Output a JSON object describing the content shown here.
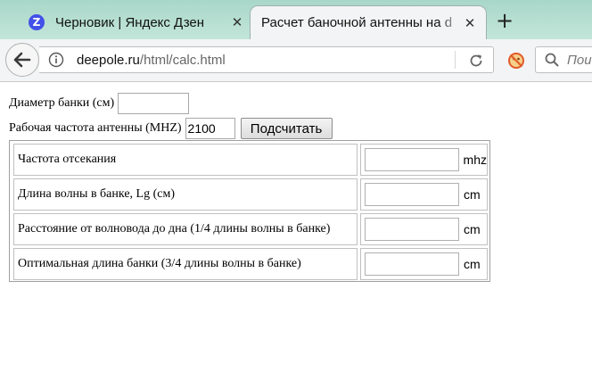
{
  "tabs": [
    {
      "favicon": "Z",
      "title": "Черновик | Яндекс Дзен",
      "active": false
    },
    {
      "title": "Расчет баночной антенны на d",
      "active": true
    }
  ],
  "new_tab_label": "+",
  "tab_close_glyph": "✕",
  "address": {
    "host": "deepole.ru",
    "path": "/html/calc.html"
  },
  "search": {
    "placeholder": "Поис"
  },
  "icons": {
    "back": "back-arrow-icon",
    "info": "info-icon",
    "reload": "reload-icon",
    "addon": "no-ads-addon-icon",
    "search": "search-icon",
    "favicon_color": "#4251e8"
  },
  "form": {
    "diameter_label": "Диаметр банки (см)",
    "diameter_value": "",
    "frequency_label": "Рабочая частота антенны (MHZ)",
    "frequency_value": "2100",
    "calc_button": "Подсчитать"
  },
  "results": [
    {
      "label": "Частота отсекания",
      "value": "",
      "unit": "mhz"
    },
    {
      "label": "Длина волны в банке, Lg (см)",
      "value": "",
      "unit": "cm"
    },
    {
      "label": "Расстояние от волновода до дна (1/4 длины волны в банке)",
      "value": "",
      "unit": "cm"
    },
    {
      "label": "Оптимальная длина банки (3/4 длины волны в банке)",
      "value": "",
      "unit": "cm"
    }
  ]
}
